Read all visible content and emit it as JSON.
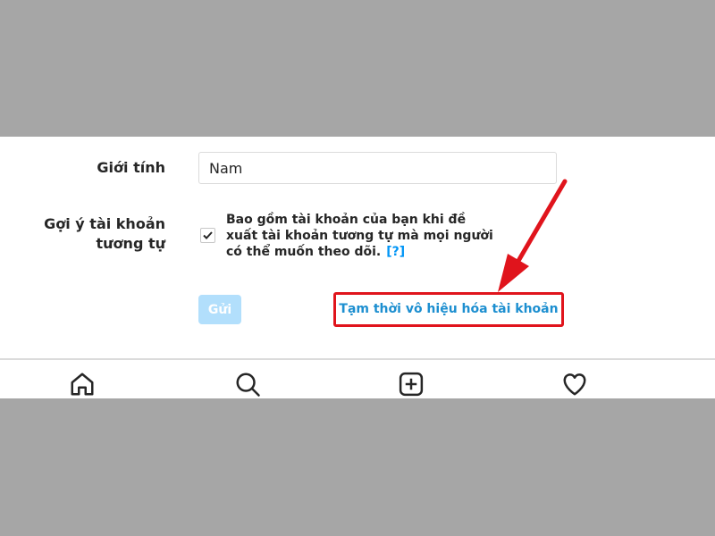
{
  "profile_form": {
    "gender_label": "Giới tính",
    "gender_value": "Nam",
    "similar_accounts_label": "Gợi ý tài khoản tương tự",
    "similar_accounts_description": "Bao gồm tài khoản của bạn khi đề xuất tài khoản tương tự mà mọi người có thể muốn theo dõi.",
    "similar_accounts_checked": true,
    "help_link_label": "[?]",
    "submit_label": "Gửi",
    "disable_account_label": "Tạm thời vô hiệu hóa tài khoản"
  },
  "annotation": {
    "highlight_color": "#e0141c"
  },
  "bottom_nav": {
    "icons": [
      "home-icon",
      "search-icon",
      "add-post-icon",
      "heart-icon"
    ]
  }
}
